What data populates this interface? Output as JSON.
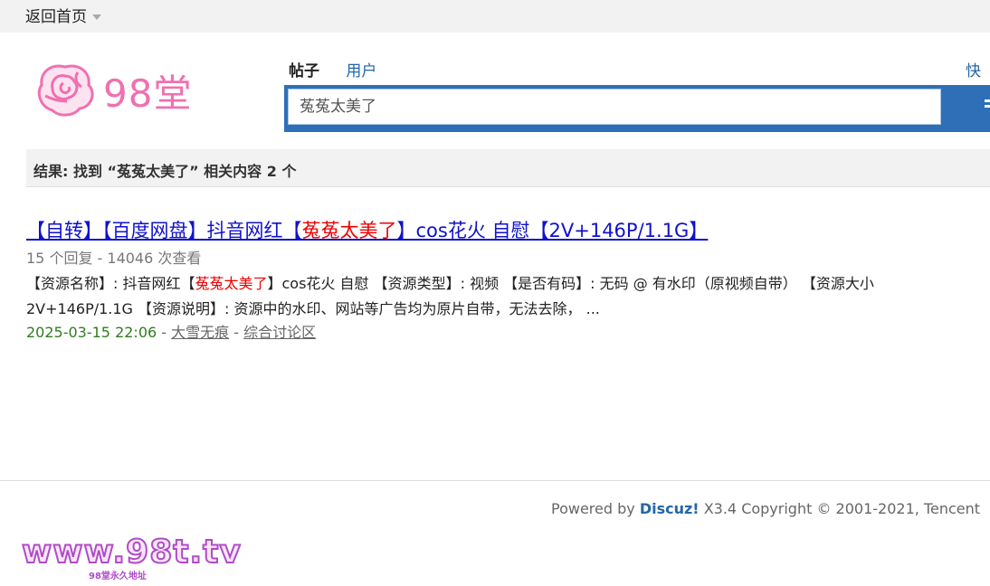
{
  "topbar": {
    "home_label": "返回首页"
  },
  "logo": {
    "text": "98堂",
    "color": "#f070b0"
  },
  "search": {
    "tabs": [
      {
        "label": "帖子",
        "active": true
      },
      {
        "label": "用户",
        "active": false
      }
    ],
    "quick_label": "快速",
    "query": "菟菟太美了",
    "accent": "#2f6fb8"
  },
  "result_summary": {
    "prefix": "结果: 找到 “",
    "keyword": "菟菟太美了",
    "suffix": "” 相关内容 2 个"
  },
  "results": [
    {
      "title_pre": "【自转】【百度网盘】抖音网红【",
      "title_hl": "菟菟太美了",
      "title_post": "】cos花火 自慰【2V+146P/1.1G】",
      "stats": "15 个回复 - 14046 次查看",
      "desc_line1_pre": "【资源名称】: 抖音网红【",
      "desc_line1_hl": "菟菟太美了",
      "desc_line1_post": "】cos花火 自慰 【资源类型】: 视频 【是否有码】: 无码 @ 有水印（原视频自带） 【资源大小",
      "desc_line2": "2V+146P/1.1G 【资源说明】: 资源中的水印、网站等广告均为原片自带，无法去除， ...",
      "date": "2025-03-15 22:06",
      "sep": " - ",
      "author": "大雪无痕",
      "forum": "综合讨论区"
    }
  ],
  "footer": {
    "powered_pre": "Powered by ",
    "brand": "Discuz!",
    "version": " X3.4   Copyright © 2001-2021, Tencent"
  },
  "watermark": {
    "text": "www.98t.tv",
    "sub": "98堂永久地址"
  }
}
